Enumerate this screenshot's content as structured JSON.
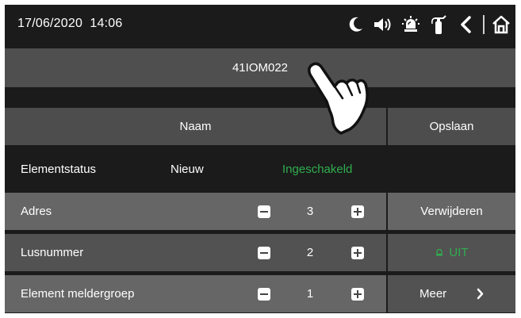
{
  "status_bar": {
    "date": "17/06/2020",
    "time": "14:06",
    "icons": [
      "moon-icon",
      "speaker-icon",
      "siren-icon",
      "extinguisher-icon",
      "back-icon",
      "home-icon"
    ]
  },
  "element_name": "41IOM022",
  "header_row": {
    "name_button": "Naam",
    "save_button": "Opslaan"
  },
  "status_row": {
    "label": "Elementstatus",
    "state_new": "Nieuw",
    "state_enabled": "Ingeschakeld"
  },
  "params": [
    {
      "label": "Adres",
      "value": "3",
      "side_button": "Verwijderen"
    },
    {
      "label": "Lusnummer",
      "value": "2",
      "side_button": "UIT"
    },
    {
      "label": "Element meldergroep",
      "value": "1",
      "side_button": "Meer"
    }
  ],
  "colors": {
    "background": "#1b1b1b",
    "panel_dark": "#4d4d4d",
    "panel_light": "#666666",
    "accent_green": "#2fae4e"
  }
}
